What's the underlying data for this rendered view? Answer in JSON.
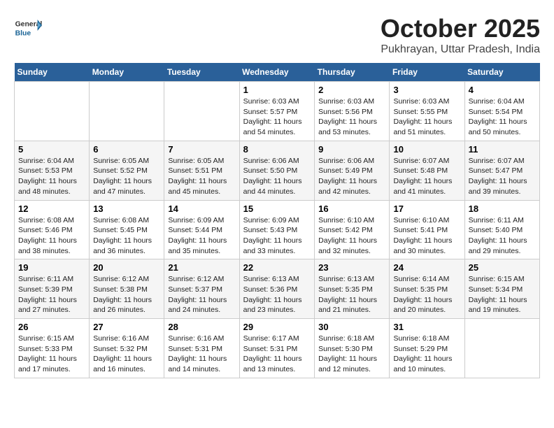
{
  "header": {
    "logo_general": "General",
    "logo_blue": "Blue",
    "month": "October 2025",
    "location": "Pukhrayan, Uttar Pradesh, India"
  },
  "days_of_week": [
    "Sunday",
    "Monday",
    "Tuesday",
    "Wednesday",
    "Thursday",
    "Friday",
    "Saturday"
  ],
  "weeks": [
    [
      {
        "day": "",
        "info": ""
      },
      {
        "day": "",
        "info": ""
      },
      {
        "day": "",
        "info": ""
      },
      {
        "day": "1",
        "info": "Sunrise: 6:03 AM\nSunset: 5:57 PM\nDaylight: 11 hours\nand 54 minutes."
      },
      {
        "day": "2",
        "info": "Sunrise: 6:03 AM\nSunset: 5:56 PM\nDaylight: 11 hours\nand 53 minutes."
      },
      {
        "day": "3",
        "info": "Sunrise: 6:03 AM\nSunset: 5:55 PM\nDaylight: 11 hours\nand 51 minutes."
      },
      {
        "day": "4",
        "info": "Sunrise: 6:04 AM\nSunset: 5:54 PM\nDaylight: 11 hours\nand 50 minutes."
      }
    ],
    [
      {
        "day": "5",
        "info": "Sunrise: 6:04 AM\nSunset: 5:53 PM\nDaylight: 11 hours\nand 48 minutes."
      },
      {
        "day": "6",
        "info": "Sunrise: 6:05 AM\nSunset: 5:52 PM\nDaylight: 11 hours\nand 47 minutes."
      },
      {
        "day": "7",
        "info": "Sunrise: 6:05 AM\nSunset: 5:51 PM\nDaylight: 11 hours\nand 45 minutes."
      },
      {
        "day": "8",
        "info": "Sunrise: 6:06 AM\nSunset: 5:50 PM\nDaylight: 11 hours\nand 44 minutes."
      },
      {
        "day": "9",
        "info": "Sunrise: 6:06 AM\nSunset: 5:49 PM\nDaylight: 11 hours\nand 42 minutes."
      },
      {
        "day": "10",
        "info": "Sunrise: 6:07 AM\nSunset: 5:48 PM\nDaylight: 11 hours\nand 41 minutes."
      },
      {
        "day": "11",
        "info": "Sunrise: 6:07 AM\nSunset: 5:47 PM\nDaylight: 11 hours\nand 39 minutes."
      }
    ],
    [
      {
        "day": "12",
        "info": "Sunrise: 6:08 AM\nSunset: 5:46 PM\nDaylight: 11 hours\nand 38 minutes."
      },
      {
        "day": "13",
        "info": "Sunrise: 6:08 AM\nSunset: 5:45 PM\nDaylight: 11 hours\nand 36 minutes."
      },
      {
        "day": "14",
        "info": "Sunrise: 6:09 AM\nSunset: 5:44 PM\nDaylight: 11 hours\nand 35 minutes."
      },
      {
        "day": "15",
        "info": "Sunrise: 6:09 AM\nSunset: 5:43 PM\nDaylight: 11 hours\nand 33 minutes."
      },
      {
        "day": "16",
        "info": "Sunrise: 6:10 AM\nSunset: 5:42 PM\nDaylight: 11 hours\nand 32 minutes."
      },
      {
        "day": "17",
        "info": "Sunrise: 6:10 AM\nSunset: 5:41 PM\nDaylight: 11 hours\nand 30 minutes."
      },
      {
        "day": "18",
        "info": "Sunrise: 6:11 AM\nSunset: 5:40 PM\nDaylight: 11 hours\nand 29 minutes."
      }
    ],
    [
      {
        "day": "19",
        "info": "Sunrise: 6:11 AM\nSunset: 5:39 PM\nDaylight: 11 hours\nand 27 minutes."
      },
      {
        "day": "20",
        "info": "Sunrise: 6:12 AM\nSunset: 5:38 PM\nDaylight: 11 hours\nand 26 minutes."
      },
      {
        "day": "21",
        "info": "Sunrise: 6:12 AM\nSunset: 5:37 PM\nDaylight: 11 hours\nand 24 minutes."
      },
      {
        "day": "22",
        "info": "Sunrise: 6:13 AM\nSunset: 5:36 PM\nDaylight: 11 hours\nand 23 minutes."
      },
      {
        "day": "23",
        "info": "Sunrise: 6:13 AM\nSunset: 5:35 PM\nDaylight: 11 hours\nand 21 minutes."
      },
      {
        "day": "24",
        "info": "Sunrise: 6:14 AM\nSunset: 5:35 PM\nDaylight: 11 hours\nand 20 minutes."
      },
      {
        "day": "25",
        "info": "Sunrise: 6:15 AM\nSunset: 5:34 PM\nDaylight: 11 hours\nand 19 minutes."
      }
    ],
    [
      {
        "day": "26",
        "info": "Sunrise: 6:15 AM\nSunset: 5:33 PM\nDaylight: 11 hours\nand 17 minutes."
      },
      {
        "day": "27",
        "info": "Sunrise: 6:16 AM\nSunset: 5:32 PM\nDaylight: 11 hours\nand 16 minutes."
      },
      {
        "day": "28",
        "info": "Sunrise: 6:16 AM\nSunset: 5:31 PM\nDaylight: 11 hours\nand 14 minutes."
      },
      {
        "day": "29",
        "info": "Sunrise: 6:17 AM\nSunset: 5:31 PM\nDaylight: 11 hours\nand 13 minutes."
      },
      {
        "day": "30",
        "info": "Sunrise: 6:18 AM\nSunset: 5:30 PM\nDaylight: 11 hours\nand 12 minutes."
      },
      {
        "day": "31",
        "info": "Sunrise: 6:18 AM\nSunset: 5:29 PM\nDaylight: 11 hours\nand 10 minutes."
      },
      {
        "day": "",
        "info": ""
      }
    ]
  ]
}
